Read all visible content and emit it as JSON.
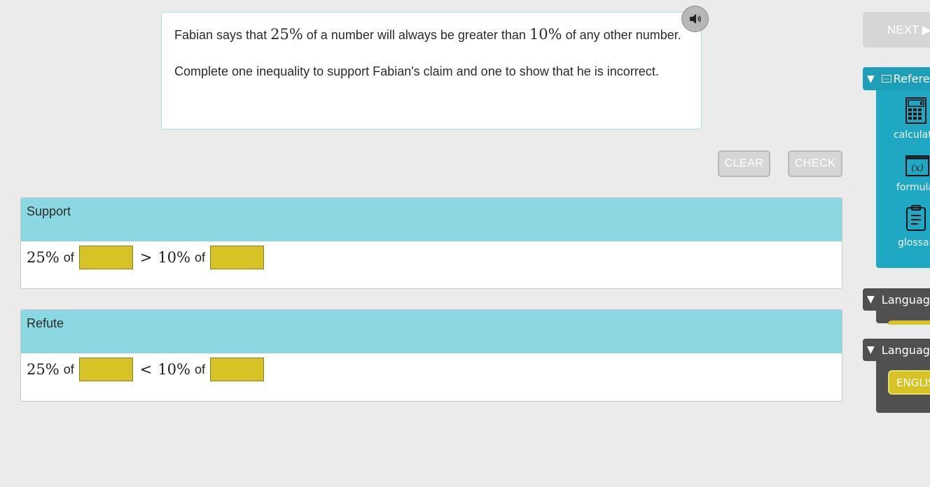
{
  "prompt": {
    "line1_pre": "Fabian says that ",
    "pct_a": "25%",
    "line1_mid": " of a number will always be greater than ",
    "pct_b": "10%",
    "line1_post": " of any other number.",
    "line2": "Complete one inequality to support Fabian's claim and one to show that he is incorrect."
  },
  "actions": {
    "clear_label": "CLEAR",
    "check_label": "CHECK"
  },
  "support": {
    "title": "Support",
    "left_pct": "25%",
    "of1": "of",
    "relation": ">",
    "right_pct": "10%",
    "of2": "of"
  },
  "refute": {
    "title": "Refute",
    "left_pct": "25%",
    "of1": "of",
    "relation": "<",
    "right_pct": "10%",
    "of2": "of"
  },
  "sidebar": {
    "next_label": "NEXT ▶",
    "reference_label": "Refere",
    "items": [
      {
        "label": "calculat",
        "icon": "calculator-icon"
      },
      {
        "label": "formula",
        "icon": "formula-icon"
      },
      {
        "label": "glossar",
        "icon": "glossary-icon"
      }
    ],
    "language1_label": "Language",
    "language2_label": "Language",
    "language_button": "ENGLIS"
  },
  "colors": {
    "panel_header": "#8bd8e2",
    "drop_box": "#d8c326",
    "reference_panel": "#1fa8c3",
    "language_panel": "#505050"
  }
}
